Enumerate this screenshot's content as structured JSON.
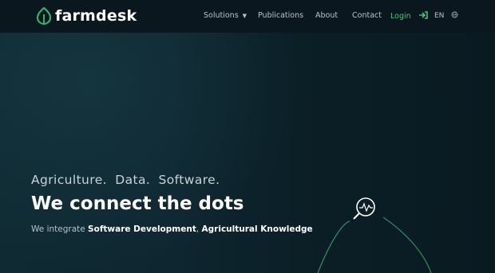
{
  "brand": {
    "name": "farmdesk",
    "accent": "#2fb36b"
  },
  "nav": {
    "solutions": "Solutions",
    "publications": "Publications",
    "about": "About",
    "contact": "Contact",
    "login": "Login",
    "language": "EN"
  },
  "hero": {
    "tagline": "Agriculture.  Data.  Software.",
    "headline": "We connect the dots",
    "intro_prefix": "We integrate ",
    "intro_bold1": "Software Development",
    "intro_sep": ", ",
    "intro_bold2": "Agricultural Knowledge"
  },
  "icons": {
    "logo": "leaf-logo-icon",
    "solutions_dropdown": "chevron-down-icon",
    "login": "login-arrow-icon",
    "language": "globe-icon",
    "hero_art": "magnifier-chart-icon"
  }
}
